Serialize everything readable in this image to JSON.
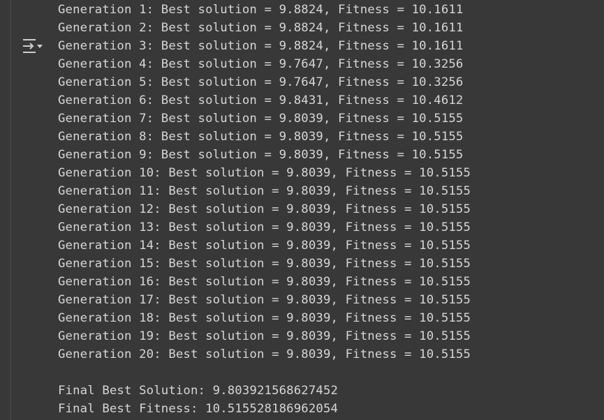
{
  "output": {
    "toggle_icon": "output-actions-icon",
    "generations": [
      "Generation 1: Best solution = 9.8824, Fitness = 10.1611",
      "Generation 2: Best solution = 9.8824, Fitness = 10.1611",
      "Generation 3: Best solution = 9.8824, Fitness = 10.1611",
      "Generation 4: Best solution = 9.7647, Fitness = 10.3256",
      "Generation 5: Best solution = 9.7647, Fitness = 10.3256",
      "Generation 6: Best solution = 9.8431, Fitness = 10.4612",
      "Generation 7: Best solution = 9.8039, Fitness = 10.5155",
      "Generation 8: Best solution = 9.8039, Fitness = 10.5155",
      "Generation 9: Best solution = 9.8039, Fitness = 10.5155",
      "Generation 10: Best solution = 9.8039, Fitness = 10.5155",
      "Generation 11: Best solution = 9.8039, Fitness = 10.5155",
      "Generation 12: Best solution = 9.8039, Fitness = 10.5155",
      "Generation 13: Best solution = 9.8039, Fitness = 10.5155",
      "Generation 14: Best solution = 9.8039, Fitness = 10.5155",
      "Generation 15: Best solution = 9.8039, Fitness = 10.5155",
      "Generation 16: Best solution = 9.8039, Fitness = 10.5155",
      "Generation 17: Best solution = 9.8039, Fitness = 10.5155",
      "Generation 18: Best solution = 9.8039, Fitness = 10.5155",
      "Generation 19: Best solution = 9.8039, Fitness = 10.5155",
      "Generation 20: Best solution = 9.8039, Fitness = 10.5155"
    ],
    "final_solution": "Final Best Solution: 9.803921568627452",
    "final_fitness": "Final Best Fitness: 10.515528186962054"
  },
  "colors": {
    "background": "#383838",
    "text": "#d6d6d6",
    "icon": "#cfcfcf"
  }
}
